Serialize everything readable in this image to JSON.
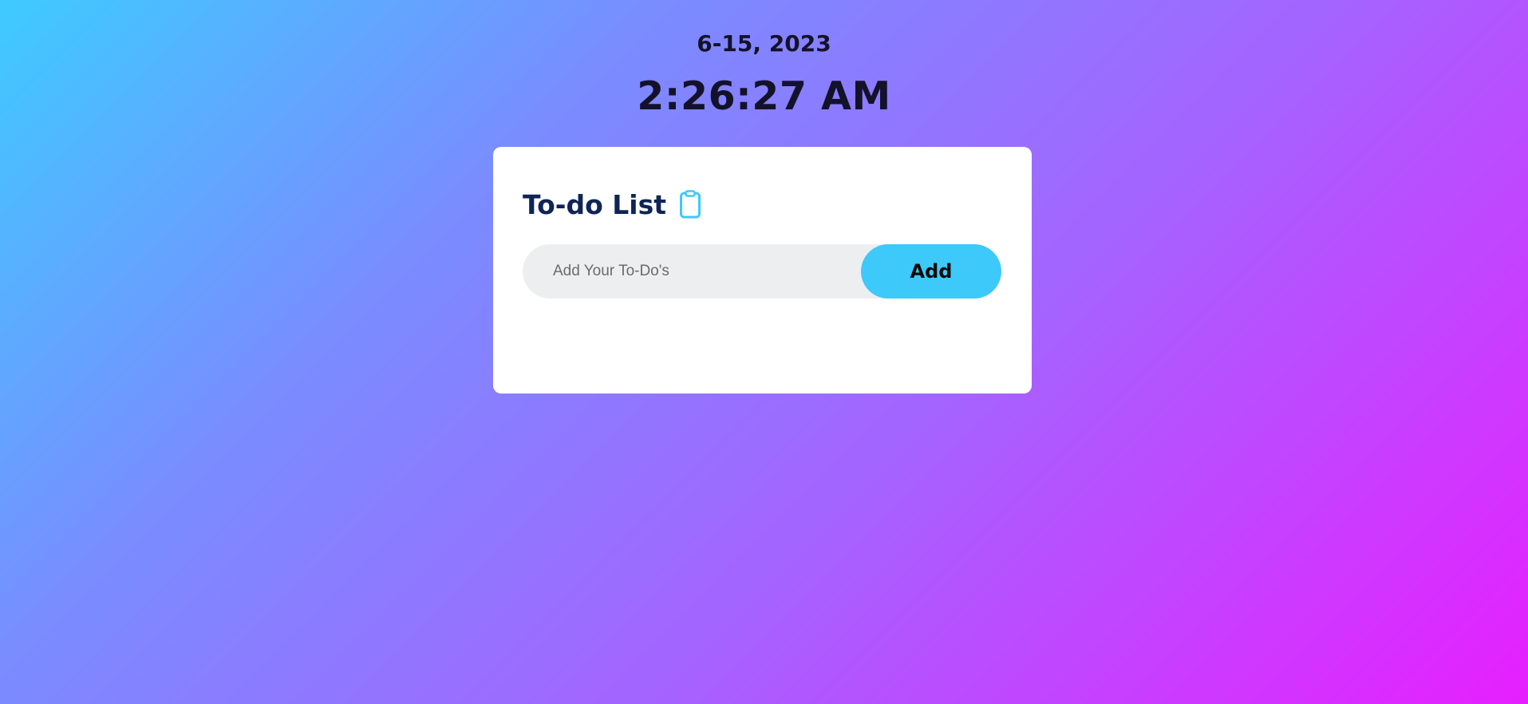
{
  "header": {
    "date": "6-15, 2023",
    "time": "2:26:27 AM"
  },
  "card": {
    "title": "To-do List",
    "title_icon": "clipboard-icon",
    "input": {
      "value": "",
      "placeholder": "Add Your To-Do's"
    },
    "add_label": "Add",
    "items": []
  },
  "colors": {
    "background_gradient": [
      "#3ecbff",
      "#7a8cff",
      "#a464ff",
      "#e61fff"
    ],
    "accent": "#3ec9fb",
    "title": "#0f2555",
    "input_bg": "#edeef0",
    "card_bg": "#ffffff"
  }
}
